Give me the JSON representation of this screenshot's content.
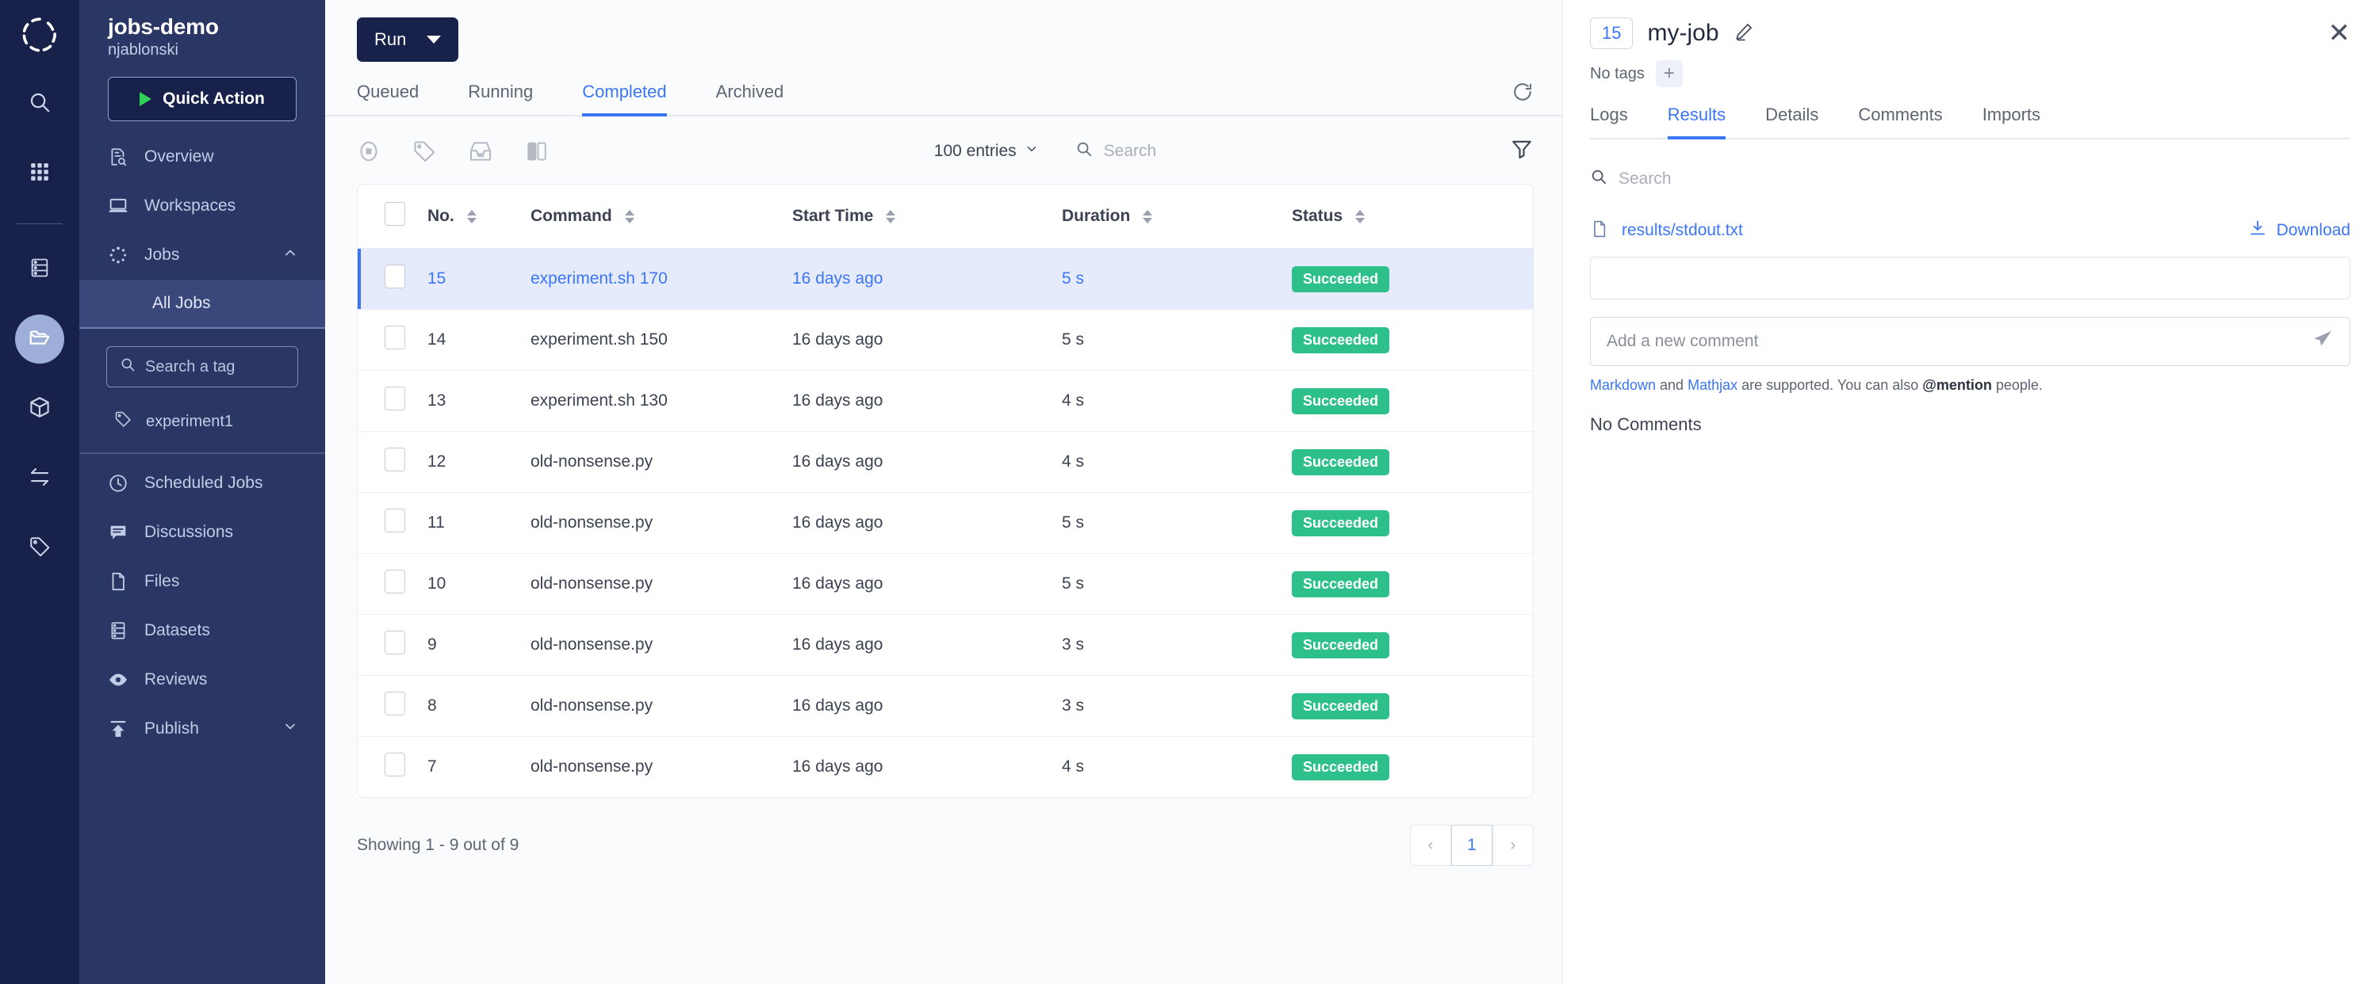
{
  "rail": {
    "logo_icon": "aperture-logo-icon",
    "items": [
      {
        "icon": "search-icon",
        "name": "rail-search",
        "active": false
      },
      {
        "icon": "grid-apps-icon",
        "name": "rail-apps",
        "active": false
      },
      {
        "icon": "datasets-icon",
        "name": "rail-datasets",
        "active": false
      },
      {
        "icon": "folder-open-icon",
        "name": "rail-files",
        "active": true
      },
      {
        "icon": "cube-icon",
        "name": "rail-environments",
        "active": false
      },
      {
        "icon": "transfer-arrows-icon",
        "name": "rail-transfer",
        "active": false
      },
      {
        "icon": "tag-icon",
        "name": "rail-tags",
        "active": false
      }
    ]
  },
  "sidebar": {
    "project_title": "jobs-demo",
    "project_owner": "njablonski",
    "quick_action_label": "Quick Action",
    "items": [
      {
        "label": "Overview",
        "icon": "overview-icon"
      },
      {
        "label": "Workspaces",
        "icon": "workspace-laptop-icon"
      },
      {
        "label": "Jobs",
        "icon": "jobs-spinner-icon",
        "expanded": true
      }
    ],
    "jobs_subitem": "All Jobs",
    "tag_search_placeholder": "Search a tag",
    "tags": [
      {
        "label": "experiment1",
        "icon": "tag-icon"
      }
    ],
    "lower_items": [
      {
        "label": "Scheduled Jobs",
        "icon": "clock-icon"
      },
      {
        "label": "Discussions",
        "icon": "chat-icon"
      },
      {
        "label": "Files",
        "icon": "file-icon"
      },
      {
        "label": "Datasets",
        "icon": "datasets-icon"
      },
      {
        "label": "Reviews",
        "icon": "eye-icon"
      },
      {
        "label": "Publish",
        "icon": "publish-upload-icon",
        "has_chevron": true
      }
    ]
  },
  "main": {
    "run_label": "Run",
    "tabs": [
      {
        "label": "Queued",
        "active": false
      },
      {
        "label": "Running",
        "active": false
      },
      {
        "label": "Completed",
        "active": true
      },
      {
        "label": "Archived",
        "active": false
      }
    ],
    "refresh_icon": "refresh-icon",
    "toolbar_icons": [
      {
        "name": "stop-icon"
      },
      {
        "name": "tag-icon"
      },
      {
        "name": "archive-icon"
      },
      {
        "name": "compare-columns-icon"
      }
    ],
    "entries_label": "100 entries",
    "search_placeholder": "Search",
    "filter_icon": "funnel-filter-icon",
    "columns": [
      "No.",
      "Command",
      "Start Time",
      "Duration",
      "Status"
    ],
    "rows": [
      {
        "no": "15",
        "command": "experiment.sh 170",
        "start_time": "16 days ago",
        "duration": "5 s",
        "status": "Succeeded",
        "selected": true
      },
      {
        "no": "14",
        "command": "experiment.sh 150",
        "start_time": "16 days ago",
        "duration": "5 s",
        "status": "Succeeded",
        "selected": false
      },
      {
        "no": "13",
        "command": "experiment.sh 130",
        "start_time": "16 days ago",
        "duration": "4 s",
        "status": "Succeeded",
        "selected": false
      },
      {
        "no": "12",
        "command": "old-nonsense.py",
        "start_time": "16 days ago",
        "duration": "4 s",
        "status": "Succeeded",
        "selected": false
      },
      {
        "no": "11",
        "command": "old-nonsense.py",
        "start_time": "16 days ago",
        "duration": "5 s",
        "status": "Succeeded",
        "selected": false
      },
      {
        "no": "10",
        "command": "old-nonsense.py",
        "start_time": "16 days ago",
        "duration": "5 s",
        "status": "Succeeded",
        "selected": false
      },
      {
        "no": "9",
        "command": "old-nonsense.py",
        "start_time": "16 days ago",
        "duration": "3 s",
        "status": "Succeeded",
        "selected": false
      },
      {
        "no": "8",
        "command": "old-nonsense.py",
        "start_time": "16 days ago",
        "duration": "3 s",
        "status": "Succeeded",
        "selected": false
      },
      {
        "no": "7",
        "command": "old-nonsense.py",
        "start_time": "16 days ago",
        "duration": "4 s",
        "status": "Succeeded",
        "selected": false
      }
    ],
    "showing_text": "Showing 1 - 9 out of 9",
    "pagination": {
      "prev": "‹",
      "current": "1",
      "next": "›"
    }
  },
  "panel": {
    "job_number": "15",
    "job_name": "my-job",
    "edit_icon": "pencil-edit-icon",
    "close_icon": "close-icon",
    "no_tags_label": "No tags",
    "add_tag_label": "+",
    "tabs": [
      {
        "label": "Logs",
        "active": false
      },
      {
        "label": "Results",
        "active": true
      },
      {
        "label": "Details",
        "active": false
      },
      {
        "label": "Comments",
        "active": false
      },
      {
        "label": "Imports",
        "active": false
      }
    ],
    "search_placeholder": "Search",
    "file_name": "results/stdout.txt",
    "file_icon": "file-icon",
    "download_label": "Download",
    "download_icon": "download-icon",
    "comment_placeholder": "Add a new comment",
    "send_icon": "send-paper-plane-icon",
    "hint": {
      "markdown": "Markdown",
      "and": " and ",
      "mathjax": "Mathjax",
      "supported": " are supported. You can also ",
      "mention": "@mention",
      "people": " people."
    },
    "no_comments": "No Comments"
  },
  "colors": {
    "accent_blue": "#3b76f6",
    "sidebar_dark": "#2a3764",
    "rail_dark": "#17214a",
    "success_green": "#2ec08b"
  }
}
